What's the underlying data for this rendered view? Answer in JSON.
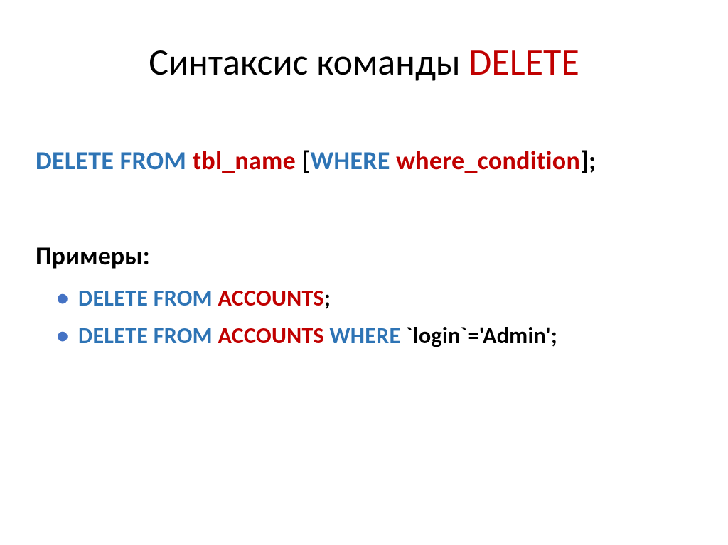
{
  "title": {
    "part1": "Синтаксис команды ",
    "part2": "DELETE"
  },
  "syntax": {
    "delete_from": "DELETE FROM",
    "tbl_name": " tbl_name ",
    "bracket_open": "[",
    "where_kw": "WHERE",
    "condition": " where_condition",
    "bracket_close": "]",
    "semicolon": ";"
  },
  "examples_label": "Примеры:",
  "example1": {
    "delete_from": "DELETE FROM",
    "table": " ACCOUNTS",
    "semicolon": ";"
  },
  "example2": {
    "delete_from": "DELETE FROM",
    "table": " ACCOUNTS ",
    "where_kw": "WHERE",
    "rest": " `login`='Admin';"
  }
}
